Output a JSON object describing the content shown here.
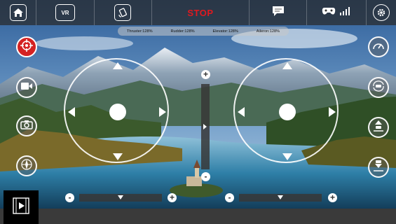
{
  "topbar": {
    "home_icon": "home-icon",
    "vr_label": "VR",
    "gravity_icon": "phone-rotate-icon",
    "stop_label": "STOP",
    "message_icon": "message-icon",
    "gamepad_icon": "gamepad-icon",
    "signal_icon": "signal-bars-icon",
    "settings_icon": "gear-icon"
  },
  "trims": {
    "thruster": "Thruster:128%",
    "rudder": "Rudder:128%",
    "elevator": "Elevator:128%",
    "aileron": "Aileron:128%"
  },
  "left_buttons": [
    {
      "icon": "target-crosshair-icon",
      "active": true
    },
    {
      "icon": "video-camera-icon",
      "active": false
    },
    {
      "icon": "photo-camera-icon",
      "active": false
    },
    {
      "icon": "compass-icon",
      "active": false
    }
  ],
  "right_buttons": [
    {
      "icon": "speedometer-icon"
    },
    {
      "icon": "flip-360-icon"
    },
    {
      "icon": "takeoff-icon"
    },
    {
      "icon": "landing-icon"
    }
  ],
  "vertical_slider": {
    "plus": "+",
    "minus": "-",
    "level": 0.5
  },
  "bottom_trims": [
    {
      "minus": "-",
      "plus": "+",
      "level": 0.5
    },
    {
      "minus": "-",
      "plus": "+",
      "level": 0.5
    }
  ],
  "colors": {
    "stop_red": "#e0191f",
    "active_red": "#d42222"
  }
}
